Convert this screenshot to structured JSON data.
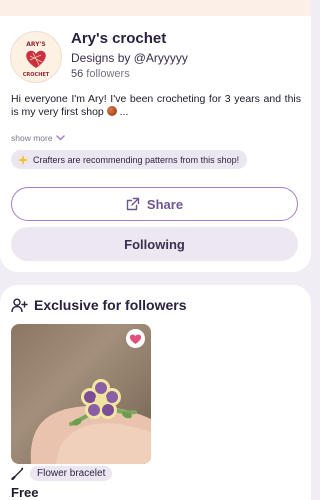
{
  "shop": {
    "avatar_text_top": "ARY'S",
    "avatar_text_bottom": "CROCHET",
    "name": "Ary's crochet",
    "designs_prefix": "Designs by ",
    "designer": "@Aryyyyy",
    "followers_count": "56",
    "followers_label": " followers",
    "bio": "Hi everyone I'm Ary! I've been crocheting for 3 years and this is my very first shop",
    "bio_suffix": " ...",
    "show_more": "show more",
    "recommend_chip": "Crafters are recommending patterns from this shop!",
    "share_label": "Share",
    "following_label": "Following"
  },
  "exclusive": {
    "title": "Exclusive for followers",
    "product": {
      "tag": "Flower bracelet",
      "price": "Free",
      "favorited": true
    }
  },
  "colors": {
    "accent": "#a87cc7",
    "heart": "#e0517f",
    "chip_bg": "#ece6f1"
  },
  "icons": {
    "avatar": "yarn-heart-logo",
    "show_more": "chevron-down-icon",
    "chip": "sparkle-icon",
    "share": "share-icon",
    "exclusive": "add-person-icon",
    "heart": "heart-icon",
    "tag": "crochet-hook-icon"
  }
}
